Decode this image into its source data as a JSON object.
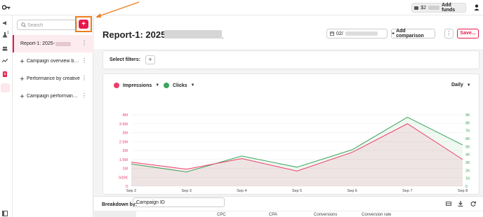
{
  "header": {
    "balance_prefix": "$2",
    "add_funds_label": "Add funds"
  },
  "sidebar": {
    "search_placeholder": "Search",
    "add_label": "+",
    "reports": [
      {
        "label": "Report-1: 2025-",
        "active": true
      },
      {
        "label": "Campaign overview by date",
        "active": false
      },
      {
        "label": "Performance by creative",
        "active": false
      },
      {
        "label": "Campaign performance b...",
        "active": false
      }
    ]
  },
  "rail": {
    "badge": "1"
  },
  "main": {
    "title": "Report-1: 2025",
    "title_suffix": ".",
    "date_prefix": "02/",
    "add_comparison_label": "Add comparison",
    "more_label": "⋮",
    "save_label": "Save..."
  },
  "filters": {
    "label": "Select filters:",
    "add_label": "+"
  },
  "chart": {
    "granularity": "Daily",
    "colors": {
      "impressions": "#ec3d6b",
      "clicks": "#3ca55c"
    }
  },
  "chart_data": {
    "type": "line",
    "x": [
      "Sep 2",
      "Sep 3",
      "Sep 4",
      "Sep 5",
      "Sep 6",
      "Sep 7",
      "Sep 8"
    ],
    "series": [
      {
        "name": "Impressions",
        "axis": "left",
        "values": [
          1.35,
          0.95,
          1.55,
          0.85,
          1.9,
          3.5,
          1.5
        ]
      },
      {
        "name": "Clicks",
        "axis": "right",
        "values": [
          2.8,
          1.8,
          3.8,
          2.4,
          4.6,
          8.7,
          5.2
        ]
      }
    ],
    "y_left": {
      "ticks": [
        "0",
        "500K",
        "1M",
        "1.5M",
        "2M",
        "2.5M",
        "3M",
        "3.5M",
        "4M"
      ],
      "range": [
        0,
        4
      ]
    },
    "y_right": {
      "ticks": [
        "0",
        "1K",
        "2K",
        "3K",
        "4K",
        "5K",
        "6K",
        "7K",
        "8K",
        "9K"
      ],
      "range": [
        0,
        9
      ]
    },
    "grid": true,
    "legend_position": "top-left"
  },
  "breakdown": {
    "label": "Breakdown by:",
    "value": "Campaign ID"
  },
  "table": {
    "columns": [
      "CPC",
      "CPA",
      "Conversions",
      "Conversion rate"
    ]
  }
}
